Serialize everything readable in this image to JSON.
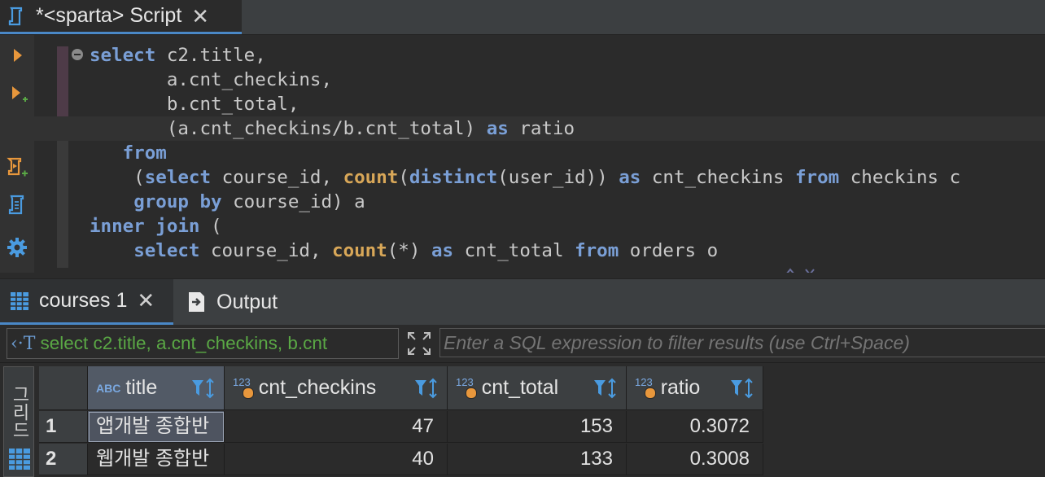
{
  "editor_tab": {
    "icon": "script-icon",
    "label": "*<sparta> Script",
    "close": "✕"
  },
  "left_toolbar": [
    {
      "name": "execute-statement-button",
      "icon": "play-icon"
    },
    {
      "name": "execute-in-new-tab-button",
      "icon": "play-plus-icon"
    },
    {
      "name": "execute-script-button",
      "icon": "script-run-icon"
    },
    {
      "name": "execute-script-new-tab-button",
      "icon": "script-run-plus-icon"
    },
    {
      "name": "explain-plan-button",
      "icon": "document-icon"
    },
    {
      "name": "settings-button",
      "icon": "gear-icon"
    }
  ],
  "sql_lines": [
    "select c2.title,",
    "       a.cnt_checkins,",
    "       b.cnt_total,",
    "       (a.cnt_checkins/b.cnt_total) as ratio",
    "   from",
    "    (select course_id, count(distinct(user_id)) as cnt_checkins from checkins c",
    "    group by course_id) a",
    "inner join (",
    "    select course_id, count(*) as cnt_total from orders o"
  ],
  "results_tabs": {
    "active_label": "courses 1",
    "active_close": "✕",
    "output_label": "Output"
  },
  "filter": {
    "sql_icon": "‹·T",
    "sql_preview": "select c2.title, a.cnt_checkins, b.cnt",
    "placeholder": "Enter a SQL expression to filter results (use Ctrl+Space)"
  },
  "grid": {
    "side_tab_label": "그리드",
    "columns": [
      {
        "name": "title",
        "type_badge": "ABC"
      },
      {
        "name": "cnt_checkins",
        "type_badge": "123"
      },
      {
        "name": "cnt_total",
        "type_badge": "123"
      },
      {
        "name": "ratio",
        "type_badge": "123"
      }
    ],
    "rows": [
      {
        "n": "1",
        "title": "앱개발 종합반",
        "cnt_checkins": "47",
        "cnt_total": "153",
        "ratio": "0.3072"
      },
      {
        "n": "2",
        "title": "웹개발 종합반",
        "cnt_checkins": "40",
        "cnt_total": "133",
        "ratio": "0.3008"
      }
    ]
  },
  "colors": {
    "accent": "#4a88c7",
    "keyword_blue": "#7a9fd6",
    "keyword_green": "#6fa252",
    "function_orange": "#d8a758",
    "filter_sql_green": "#5aa845",
    "run_icon_orange": "#e8973c"
  }
}
